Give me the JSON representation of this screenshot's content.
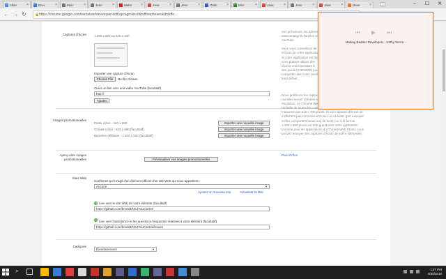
{
  "tabs": [
    {
      "title": "Allan",
      "color": "#4a8cd8"
    },
    {
      "title": "Envi",
      "color": "#3a7bd5"
    },
    {
      "title": "Myrc",
      "color": "#777777"
    },
    {
      "title": "Jeso",
      "color": "#777777"
    },
    {
      "title": "Make",
      "color": "#cc2222"
    },
    {
      "title": "Java",
      "color": "#dd4444"
    },
    {
      "title": "Jeso",
      "color": "#777777"
    },
    {
      "title": "Onlin",
      "color": "#3060c0"
    },
    {
      "title": "Micr",
      "color": "#2b8a3e"
    },
    {
      "title": "Java",
      "color": "#dd4444"
    },
    {
      "title": "Jeso",
      "color": "#777777"
    },
    {
      "title": "Java",
      "color": "#dd4444"
    },
    {
      "title": "Deve",
      "color": "#e0782e"
    }
  ],
  "address": {
    "url": "https://chrome.google.com/webstore/developer/edit/apcagmkiicdbhvffhiephnaeokdmkffe..."
  },
  "sections": {
    "screenshots": {
      "label": "Captures d'écran",
      "size": "1 280 x 800 ou 640 x 400",
      "import_label": "Importer une capture d'écran",
      "choose_file": "Choose File",
      "no_file": "No file chosen",
      "youtube_label": "Créer un lien vers une vidéo YouTube (facultatif)",
      "youtube_value": "http://",
      "add_button": "Ajouter"
    },
    "promo": {
      "label": "Images promotionnelles",
      "rows": [
        {
          "name": "Petite icône - 440 x 280",
          "button": "Importer une nouvelle image"
        },
        {
          "name": "Grande icône - 920 x 680 (facultatif)",
          "button": "Importer une nouvelle image"
        },
        {
          "name": "Bannière défilante - 1 400 x 560 (facultatif)",
          "button": "Importer une nouvelle image"
        }
      ]
    },
    "preview": {
      "label": "Aperçu des images promotionnelles",
      "button": "Prévisualiser vos images promotionnelles"
    },
    "websites": {
      "label": "Sites Web",
      "confirm_text": "Confirmez qu'il s'agit d'un élément officiel d'un site Web qui vous appartient :",
      "select_value": "Aucune",
      "add_site": "Ajouter un nouveau site",
      "update_list": "Actualiser la liste",
      "site_label": "Lien vers le site Web de votre élément (facultatif)",
      "site_value": "https://github.com/bmeldt/NSJYouControl",
      "support_label": "Lien vers l'assistance et les questions fréquentes relatives à votre élément (facultatif)",
      "support_value": "https://github.com/bmeldt/NSJYouControl/issues"
    },
    "category": {
      "label": "Catégorie",
      "select_value": "Divertissement"
    }
  },
  "help": {
    "para1": "Vos présences, les adresses\nd'accompagné d'un flux vidéo\nYouTube\n\nVous vous conseillons de fournir au\nd'écran de votre application\nSi votre application est destinée\nvous pouvez utiliser des\nchoisis correspondant à\ndes pixels (1280x800) pour\ncomporter des coins carrés\nfond défaut.",
    "para2": "Nous préférons les captures d'écran de 1 280 x 800 pixels,\ncar elles seront utilisées sur les futures à haute\nrésolution. Le Chrome Web Store fera progressivement\nl'échelle de toutes les captures d'écran pour qu'elles ne\nmesurent que 640 x 400 pixels. Si vos captures d'écran ne\ns'affichent pas correctement une fois réduites (par exemple\ns'elles comportent beaucoup de texte) ou si le format\n1 280 x 800 pixels est trop grand pour votre application\n(comme pour les applications du Chrome Web Store), vous\npouvez envoyer des captures d'écran de 640 x 400 pixels.",
    "more_link": "Plus d'infos"
  },
  "popup": {
    "track_title": "Making Badass Developers - Kathy Sierra ..."
  },
  "taskbar": {
    "time": "1:27 PM",
    "date": "9/30/2018",
    "apps": [
      "#ffb900",
      "#3a7bd5",
      "#e04040",
      "#d9d9d9",
      "#c3362b",
      "#e0a030",
      "#5c5c8a",
      "#2f6fcf",
      "#3cb371",
      "#666699",
      "#cc3333",
      "#4a8cd8",
      "#888888"
    ]
  }
}
